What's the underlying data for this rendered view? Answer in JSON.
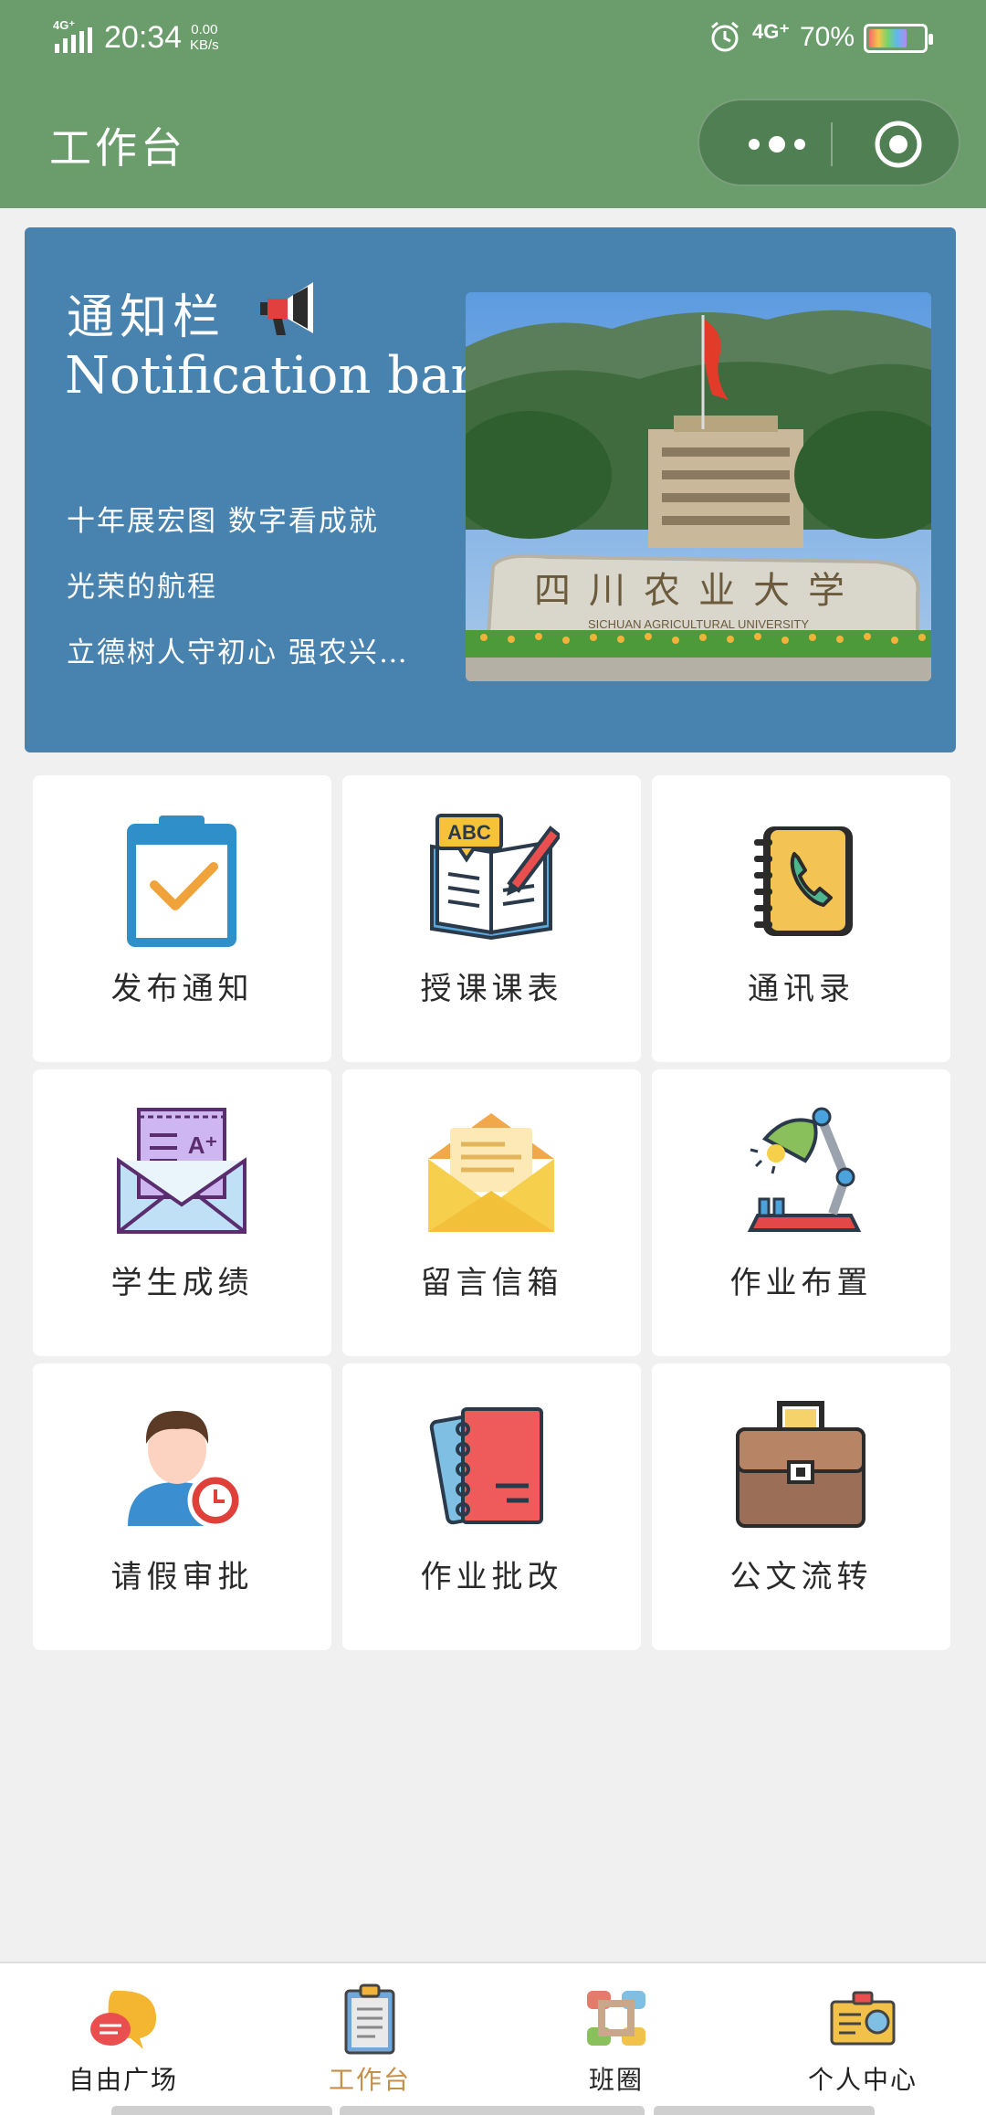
{
  "status_bar": {
    "network_left": "4G⁺",
    "time": "20:34",
    "speed_value": "0.00",
    "speed_unit": "KB/s",
    "network_right": "4G⁺",
    "battery": "70%",
    "battery_level": 0.7
  },
  "header": {
    "title": "工作台"
  },
  "notice": {
    "title_cn": "通知栏",
    "title_en": "Notification bar",
    "items": [
      "十年展宏图 数字看成就",
      "光荣的航程",
      "立德树人守初心 强农兴…"
    ],
    "photo_sign_text": "四川农业大学",
    "photo_sign_sub": "SICHUAN AGRICULTURAL UNIVERSITY"
  },
  "grid": [
    {
      "label": "发布通知",
      "icon": "clipboard-check-icon"
    },
    {
      "label": "授课课表",
      "icon": "book-pencil-icon"
    },
    {
      "label": "通讯录",
      "icon": "address-book-icon"
    },
    {
      "label": "学生成绩",
      "icon": "grade-letter-icon"
    },
    {
      "label": "留言信箱",
      "icon": "envelope-icon"
    },
    {
      "label": "作业布置",
      "icon": "desk-lamp-icon"
    },
    {
      "label": "请假审批",
      "icon": "user-clock-icon"
    },
    {
      "label": "作业批改",
      "icon": "notebook-icon"
    },
    {
      "label": "公文流转",
      "icon": "briefcase-icon"
    }
  ],
  "tabbar": [
    {
      "label": "自由广场",
      "icon": "chat-bubbles-icon",
      "active": false
    },
    {
      "label": "工作台",
      "icon": "clipboard-icon",
      "active": true
    },
    {
      "label": "班圈",
      "icon": "hands-circle-icon",
      "active": false
    },
    {
      "label": "个人中心",
      "icon": "id-card-icon",
      "active": false
    }
  ],
  "colors": {
    "header_bg": "#6a9d6b",
    "notice_bg": "#4883b0",
    "active_tab": "#c58f4a",
    "page_bg": "#f0f0f0"
  }
}
